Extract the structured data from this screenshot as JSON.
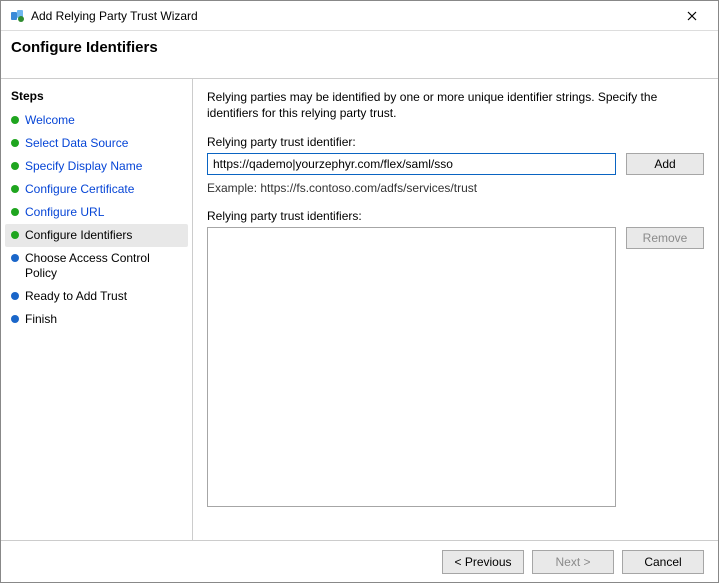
{
  "window": {
    "title": "Add Relying Party Trust Wizard"
  },
  "page_heading": "Configure Identifiers",
  "sidebar": {
    "heading": "Steps",
    "items": [
      {
        "label": "Welcome"
      },
      {
        "label": "Select Data Source"
      },
      {
        "label": "Specify Display Name"
      },
      {
        "label": "Configure Certificate"
      },
      {
        "label": "Configure URL"
      },
      {
        "label": "Configure Identifiers"
      },
      {
        "label": "Choose Access Control Policy"
      },
      {
        "label": "Ready to Add Trust"
      },
      {
        "label": "Finish"
      }
    ]
  },
  "main": {
    "description": "Relying parties may be identified by one or more unique identifier strings. Specify the identifiers for this relying party trust.",
    "identifier_label": "Relying party trust identifier:",
    "identifier_value": "https://qademo|yourzephyr.com/flex/saml/sso",
    "example": "Example: https://fs.contoso.com/adfs/services/trust",
    "list_label": "Relying party trust identifiers:",
    "add_button": "Add",
    "remove_button": "Remove"
  },
  "footer": {
    "previous": "< Previous",
    "next": "Next >",
    "cancel": "Cancel"
  }
}
